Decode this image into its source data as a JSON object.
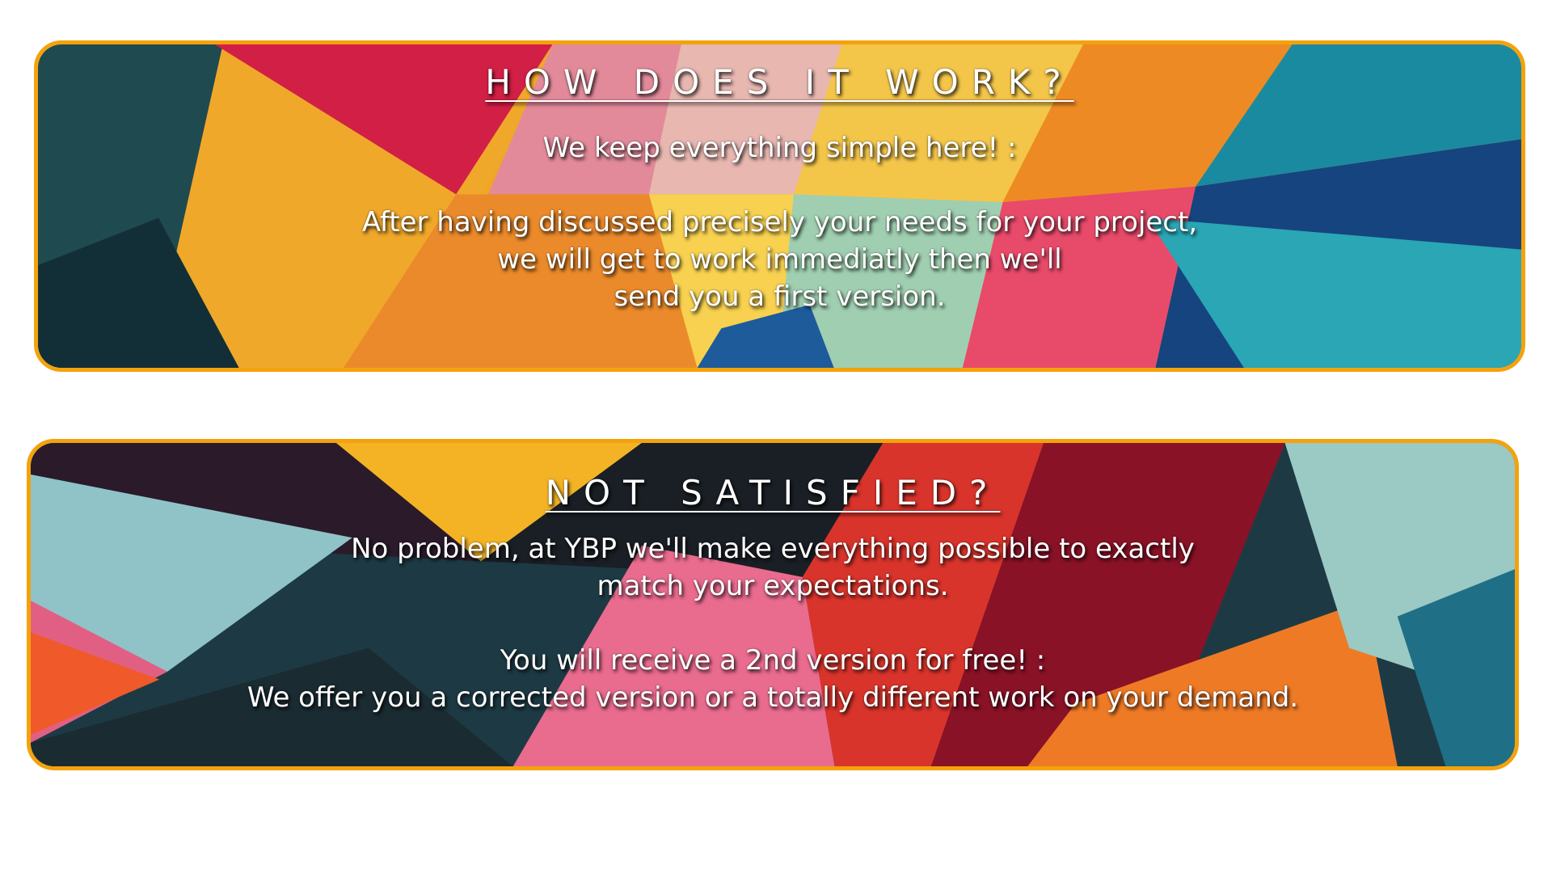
{
  "panels": [
    {
      "title": "HOW DOES IT WORK?",
      "intro": "We keep everything simple here! :",
      "lines": [
        "After having discussed precisely your needs for your project,",
        "we will get to work immediatly then we'll",
        "send you a first version."
      ]
    },
    {
      "title": "NOT SATISFIED?",
      "intro_lines": [
        "No problem, at YBP we'll make everything possible to exactly",
        "match your expectations."
      ],
      "lines": [
        "You will receive a 2nd version for free!  :",
        "We offer you a corrected version or a totally different work on your demand."
      ]
    }
  ],
  "colors": {
    "border": "#f4a20c",
    "text": "#ffffff",
    "page_background": "#ffffff"
  }
}
